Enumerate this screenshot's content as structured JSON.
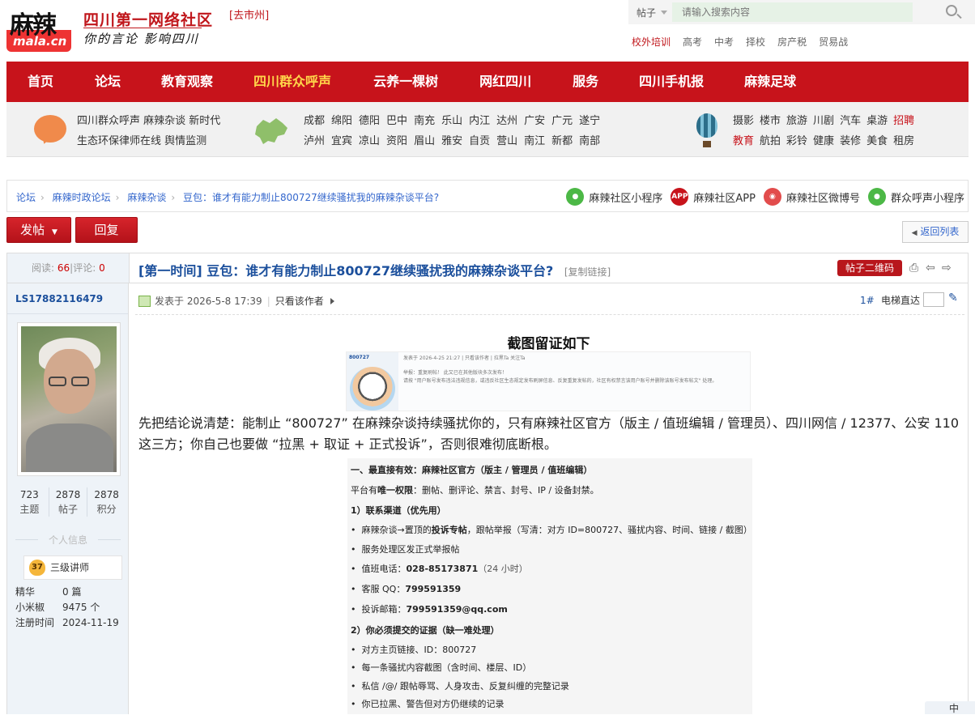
{
  "header": {
    "logo_text": "麻辣",
    "logo_sub": "mala.cn",
    "site_name": "四川第一网络社区",
    "slogan": "你的言论 影响四川",
    "city": "[去市州]",
    "search_type": "帖子",
    "search_placeholder": "请输入搜索内容",
    "quick_links": [
      "校外培训",
      "高考",
      "中考",
      "择校",
      "房产税",
      "贸易战"
    ]
  },
  "nav": [
    "首页",
    "论坛",
    "教育观察",
    "四川群众呼声",
    "云养一棵树",
    "网红四川",
    "服务",
    "四川手机报",
    "麻辣足球"
  ],
  "nav_active": "四川群众呼声",
  "subnav": {
    "col1": [
      "四川群众呼声 麻辣杂谈 新时代",
      "生态环保律师在线 舆情监测"
    ],
    "cities": [
      [
        "成都",
        "绵阳",
        "德阳",
        "巴中",
        "南充",
        "乐山",
        "内江",
        "达州",
        "广安",
        "广元",
        "遂宁"
      ],
      [
        "泸州",
        "宜宾",
        "凉山",
        "资阳",
        "眉山",
        "雅安",
        "自贡",
        "营山",
        "南江",
        "新都",
        "南部"
      ]
    ],
    "life": [
      [
        "摄影",
        "楼市",
        "旅游",
        "川剧",
        "汽车",
        "桌游",
        "招聘"
      ],
      [
        "教育",
        "航拍",
        "彩铃",
        "健康",
        "装修",
        "美食",
        "租房"
      ]
    ]
  },
  "breadcrumb": {
    "items": [
      "论坛",
      "麻辣时政论坛",
      "麻辣杂谈",
      "豆包：谁才有能力制止800727继续骚扰我的麻辣杂谈平台?"
    ],
    "apps": [
      {
        "label": "麻辣社区小程序",
        "color": "#4cb846",
        "icon": "wechat-icon"
      },
      {
        "label": "麻辣社区APP",
        "color": "#c7131b",
        "icon": "app-icon",
        "badge": "APP"
      },
      {
        "label": "麻辣社区微博号",
        "color": "#e24c4c",
        "icon": "weibo-icon"
      },
      {
        "label": "群众呼声小程序",
        "color": "#4cb846",
        "icon": "wechat-icon"
      }
    ]
  },
  "actions": {
    "post": "发帖",
    "reply": "回复",
    "back": "返回列表"
  },
  "thread": {
    "read_label": "阅读:",
    "read_count": "66",
    "comment_label": "评论:",
    "comment_count": "0",
    "title": "[第一时间] 豆包：谁才有能力制止800727继续骚扰我的麻辣杂谈平台?",
    "copy_link": "[复制链接]",
    "qr_label": "帖子二维码"
  },
  "author": {
    "name": "LS17882116479",
    "stats": [
      {
        "value": "723",
        "label": "主题"
      },
      {
        "value": "2878",
        "label": "帖子"
      },
      {
        "value": "2878",
        "label": "积分"
      }
    ],
    "info_title": "个人信息",
    "rank_level": "37",
    "rank": "三级讲师",
    "meta": [
      {
        "k": "精华",
        "v": "0 篇"
      },
      {
        "k": "小米椒",
        "v": "9475 个"
      },
      {
        "k": "注册时间",
        "v": "2024-11-19"
      }
    ]
  },
  "post": {
    "posted_at": "发表于 2026-5-8 17:39",
    "only_author": "只看该作者",
    "floor": "1#",
    "lift_label": "电梯直达",
    "heading": "截图留证如下",
    "shot1": {
      "uid": "800727",
      "line1": "发表于 2026-4-25 21:27 | 只看该作者 | 拉黑Ta 关注Ta",
      "line2": "举报：重复刷帖！ 此又已在其他版块多次发布！",
      "line3": "请按 \"用户账号发布违法违规信息，或违反社区生态规定发布刷屏信息、反复重复发帖的，社区有权禁言该用户账号并删除该账号发布帖文\" 处理。"
    },
    "paragraph": "先把结论说清楚：能制止 “800727” 在麻辣杂谈持续骚扰你的，只有麻辣社区官方（版主 / 值班编辑 / 管理员）、四川网信 / 12377、公安 110 这三方；你自己也要做 “拉黑 + 取证 + 正式投诉”，否则很难彻底断根。",
    "shot2": {
      "h1": "一、最直接有效：麻辣社区官方（版主 / 管理员 / 值班编辑）",
      "p_pre": "平台有",
      "p_bold": "唯一权限",
      "p_post": "：删帖、删评论、禁言、封号、IP / 设备封禁。",
      "s1": "1）联系渠道（优先用）",
      "li1_pre": "麻辣杂谈→置顶的",
      "li1_bold": "投诉专帖",
      "li1_post": "，跟帖举报（写清：对方 ID=800727、骚扰内容、时间、链接 / 截图）",
      "li2": "服务处理区发正式举报帖",
      "li3_pre": "值班电话：",
      "li3_bold": "028-85173871",
      "li3_post": "（24 小时）",
      "li4_pre": "客服 QQ：",
      "li4_bold": "799591359",
      "li5_pre": "投诉邮箱：",
      "li5_bold": "799591359@qq.com",
      "s2": "2）你必须提交的证据（缺一难处理）",
      "li6": "对方主页链接、ID：800727",
      "li7": "每一条骚扰内容截图（含时间、楼层、ID）",
      "li8": "私信 /@/ 跟帖辱骂、人身攻击、反复纠缠的完整记录",
      "li9": "你已拉黑、警告但对方仍继续的记录"
    }
  },
  "floating": "中"
}
